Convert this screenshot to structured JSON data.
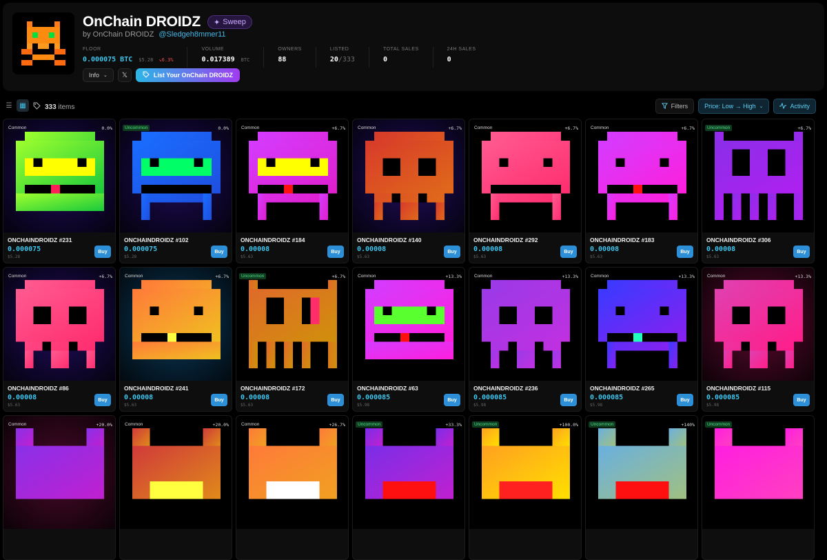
{
  "collection": {
    "title": "OnChain DROIDZ",
    "sweep_label": "Sweep",
    "by_prefix": "by OnChain DROIDZ",
    "handle": "@Sledgeh8mmer11"
  },
  "stats": [
    {
      "label": "FLOOR",
      "value": "0.000075 BTC",
      "usd": "$5.28",
      "change": "↘6.3%"
    },
    {
      "label": "VOLUME",
      "value": "0.017389",
      "unit": "BTC"
    },
    {
      "label": "OWNERS",
      "value": "88"
    },
    {
      "label": "LISTED",
      "value": "20",
      "total": "/333"
    },
    {
      "label": "TOTAL SALES",
      "value": "0"
    },
    {
      "label": "24H SALES",
      "value": "0"
    }
  ],
  "actions": {
    "info_label": "Info",
    "list_label": "List Your OnChain DROIDZ"
  },
  "toolbar": {
    "count_number": "333",
    "count_suffix": "items",
    "filters_label": "Filters",
    "sort_label": "Price: Low → High",
    "activity_label": "Activity"
  },
  "buy_label": "Buy",
  "cards": [
    {
      "name": "ONCHAINDROIDZ #231",
      "rarity": "Common",
      "change": "0.0%",
      "price": "0.000075",
      "usd": "$5.28",
      "bg": "#1d0b57",
      "colors": [
        "#9eff2e",
        "#19c93c"
      ],
      "visor": "#ffff00",
      "accent": "#ff1e55",
      "shape": "block"
    },
    {
      "name": "ONCHAINDROIDZ #102",
      "rarity": "Uncommon",
      "change": "0.0%",
      "price": "0.000075",
      "usd": "$5.28",
      "bg": "#1d0b57",
      "colors": [
        "#1a6dff",
        "#1e4fe0"
      ],
      "visor": "#00ff66",
      "accent": "",
      "shape": "legs"
    },
    {
      "name": "ONCHAINDROIDZ #184",
      "rarity": "Common",
      "change": "+6.7%",
      "price": "0.00008",
      "usd": "$5.63",
      "bg": "#000000",
      "colors": [
        "#d43cff",
        "#e01ecc"
      ],
      "visor": "#ffff00",
      "accent": "#ff1010",
      "shape": "legs"
    },
    {
      "name": "ONCHAINDROIDZ #140",
      "rarity": "Common",
      "change": "+6.7%",
      "price": "0.00008",
      "usd": "$5.63",
      "bg": "#200d5e",
      "colors": [
        "#d83a2a",
        "#e06a1a"
      ],
      "visor": "",
      "accent": "",
      "shape": "skull"
    },
    {
      "name": "ONCHAINDROIDZ #292",
      "rarity": "Common",
      "change": "+6.7%",
      "price": "0.00008",
      "usd": "$5.63",
      "bg": "#000000",
      "colors": [
        "#ff5a90",
        "#ff2d70"
      ],
      "visor": "",
      "accent": "",
      "shape": "legs"
    },
    {
      "name": "ONCHAINDROIDZ #183",
      "rarity": "Common",
      "change": "+6.7%",
      "price": "0.00008",
      "usd": "$5.63",
      "bg": "#000000",
      "colors": [
        "#d43cff",
        "#ff1edc"
      ],
      "visor": "",
      "accent": "#ff1010",
      "shape": "legs"
    },
    {
      "name": "ONCHAINDROIDZ #306",
      "rarity": "Uncommon",
      "change": "+6.7%",
      "price": "0.00008",
      "usd": "$5.63",
      "bg": "#000000",
      "colors": [
        "#8a2ee8",
        "#b020f0"
      ],
      "visor": "",
      "accent": "",
      "shape": "horns"
    },
    {
      "name": "ONCHAINDROIDZ #86",
      "rarity": "Common",
      "change": "+6.7%",
      "price": "0.00008",
      "usd": "$5.63",
      "bg": "#200d5e",
      "colors": [
        "#ff5a90",
        "#ff2d70"
      ],
      "visor": "",
      "accent": "",
      "shape": "skull"
    },
    {
      "name": "ONCHAINDROIDZ #241",
      "rarity": "Common",
      "change": "+6.7%",
      "price": "0.00008",
      "usd": "$5.63",
      "bg": "#0a3a5c",
      "colors": [
        "#ff7a3a",
        "#f0c020"
      ],
      "visor": "",
      "accent": "#ffff40",
      "shape": "block"
    },
    {
      "name": "ONCHAINDROIDZ #172",
      "rarity": "Uncommon",
      "change": "+6.7%",
      "price": "0.00008",
      "usd": "$5.63",
      "bg": "#000000",
      "colors": [
        "#e06a2a",
        "#d0900a"
      ],
      "visor": "#ff2d6a",
      "accent": "",
      "shape": "horns"
    },
    {
      "name": "ONCHAINDROIDZ #63",
      "rarity": "Common",
      "change": "+13.3%",
      "price": "0.000085",
      "usd": "$5.98",
      "bg": "#000000",
      "colors": [
        "#d43cff",
        "#ff1edc"
      ],
      "visor": "#5aff30",
      "accent": "#ff1010",
      "shape": "block"
    },
    {
      "name": "ONCHAINDROIDZ #236",
      "rarity": "Common",
      "change": "+13.3%",
      "price": "0.000085",
      "usd": "$5.98",
      "bg": "#000000",
      "colors": [
        "#9a3ae8",
        "#c030e0"
      ],
      "visor": "",
      "accent": "",
      "shape": "skull"
    },
    {
      "name": "ONCHAINDROIDZ #265",
      "rarity": "Common",
      "change": "+13.3%",
      "price": "0.000085",
      "usd": "$5.98",
      "bg": "#000000",
      "colors": [
        "#3a3aff",
        "#8a20f0"
      ],
      "visor": "",
      "accent": "#20ffc0",
      "shape": "legs"
    },
    {
      "name": "ONCHAINDROIDZ #115",
      "rarity": "Common",
      "change": "+13.3%",
      "price": "0.000085",
      "usd": "$5.98",
      "bg": "#5a0a2e",
      "colors": [
        "#e040b0",
        "#ff1e8a"
      ],
      "visor": "",
      "accent": "",
      "shape": "skull"
    },
    {
      "name": "",
      "rarity": "Common",
      "change": "+20.0%",
      "price": "",
      "usd": "",
      "bg": "#4a0a2a",
      "colors": [
        "#8a30e8",
        "#c020d0"
      ],
      "visor": "",
      "accent": "",
      "shape": "partial"
    },
    {
      "name": "",
      "rarity": "Common",
      "change": "+20.0%",
      "price": "",
      "usd": "",
      "bg": "#000000",
      "colors": [
        "#d03a3a",
        "#e08a1a"
      ],
      "visor": "#ffff40",
      "accent": "",
      "shape": "partial"
    },
    {
      "name": "",
      "rarity": "Common",
      "change": "+26.7%",
      "price": "",
      "usd": "",
      "bg": "#000000",
      "colors": [
        "#ff7a3a",
        "#f0a020"
      ],
      "visor": "#ffffff",
      "accent": "",
      "shape": "partial"
    },
    {
      "name": "",
      "rarity": "Uncommon",
      "change": "+33.3%",
      "price": "",
      "usd": "",
      "bg": "#000000",
      "colors": [
        "#7a2ee8",
        "#c020d0"
      ],
      "visor": "#ff1010",
      "accent": "",
      "shape": "partial"
    },
    {
      "name": "",
      "rarity": "Uncommon",
      "change": "+100.0%",
      "price": "",
      "usd": "",
      "bg": "#000000",
      "colors": [
        "#ffa020",
        "#ffe000"
      ],
      "visor": "#ff2020",
      "accent": "",
      "shape": "partial"
    },
    {
      "name": "",
      "rarity": "Uncommon",
      "change": "+140%",
      "price": "",
      "usd": "",
      "bg": "#000000",
      "colors": [
        "#6ab0e0",
        "#a0c080"
      ],
      "visor": "#ff1010",
      "accent": "",
      "shape": "partial"
    },
    {
      "name": "",
      "rarity": "Uncommon",
      "change": "",
      "price": "",
      "usd": "",
      "bg": "#000000",
      "colors": [
        "#ff1ee0",
        "#ff40c0"
      ],
      "visor": "",
      "accent": "",
      "shape": "partial"
    }
  ]
}
